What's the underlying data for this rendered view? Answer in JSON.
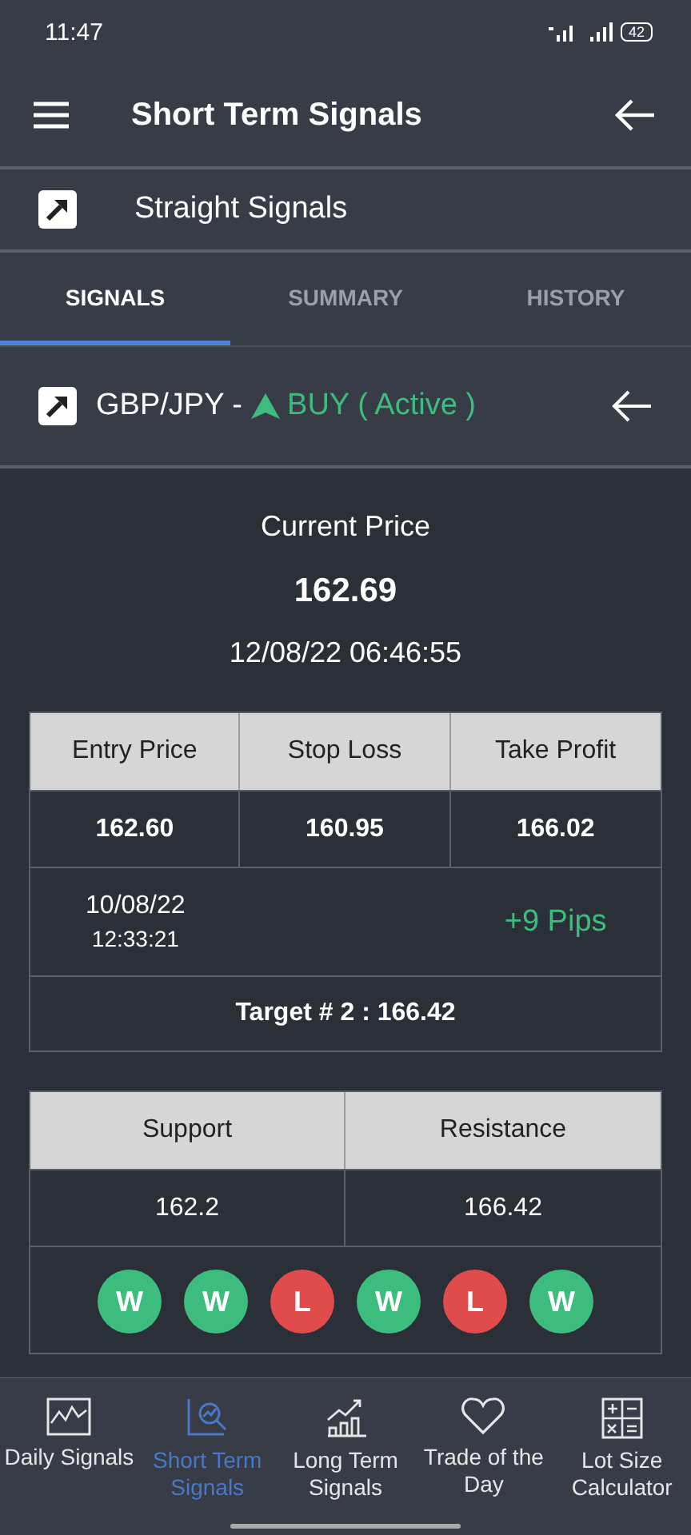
{
  "status_bar": {
    "time": "11:47",
    "battery": "42"
  },
  "header": {
    "title": "Short Term Signals"
  },
  "category": {
    "label": "Straight Signals"
  },
  "tabs": [
    {
      "label": "SIGNALS",
      "selected": true
    },
    {
      "label": "SUMMARY",
      "selected": false
    },
    {
      "label": "HISTORY",
      "selected": false
    }
  ],
  "signal": {
    "pair": "GBP/JPY -",
    "kind": "buy",
    "action": "BUY",
    "status": "( Active )"
  },
  "current": {
    "label": "Current Price",
    "price": "162.69",
    "datetime": "12/08/22 06:46:55"
  },
  "trade_table": {
    "columns": [
      "Entry Price",
      "Stop Loss",
      "Take Profit"
    ],
    "values": [
      "162.60",
      "160.95",
      "166.02"
    ],
    "opened_date": "10/08/22",
    "opened_time": "12:33:21",
    "pips": "+9 Pips",
    "target": "Target # 2 : 166.42"
  },
  "levels_table": {
    "columns": [
      "Support",
      "Resistance"
    ],
    "values": [
      "162.2",
      "166.42"
    ]
  },
  "results": [
    {
      "letter": "W",
      "color": "#3dbd7d"
    },
    {
      "letter": "W",
      "color": "#3dbd7d"
    },
    {
      "letter": "L",
      "color": "#e04b4b"
    },
    {
      "letter": "W",
      "color": "#3dbd7d"
    },
    {
      "letter": "L",
      "color": "#e04b4b"
    },
    {
      "letter": "W",
      "color": "#3dbd7d"
    }
  ],
  "nav": [
    {
      "kind": "daily",
      "label": "Daily Signals",
      "selected": false
    },
    {
      "kind": "short",
      "label": "Short Term Signals",
      "selected": true
    },
    {
      "kind": "long",
      "label": "Long Term Signals",
      "selected": false
    },
    {
      "kind": "trade",
      "label": "Trade of the Day",
      "selected": false
    },
    {
      "kind": "calc",
      "label": "Lot Size Calculator",
      "selected": false
    }
  ]
}
